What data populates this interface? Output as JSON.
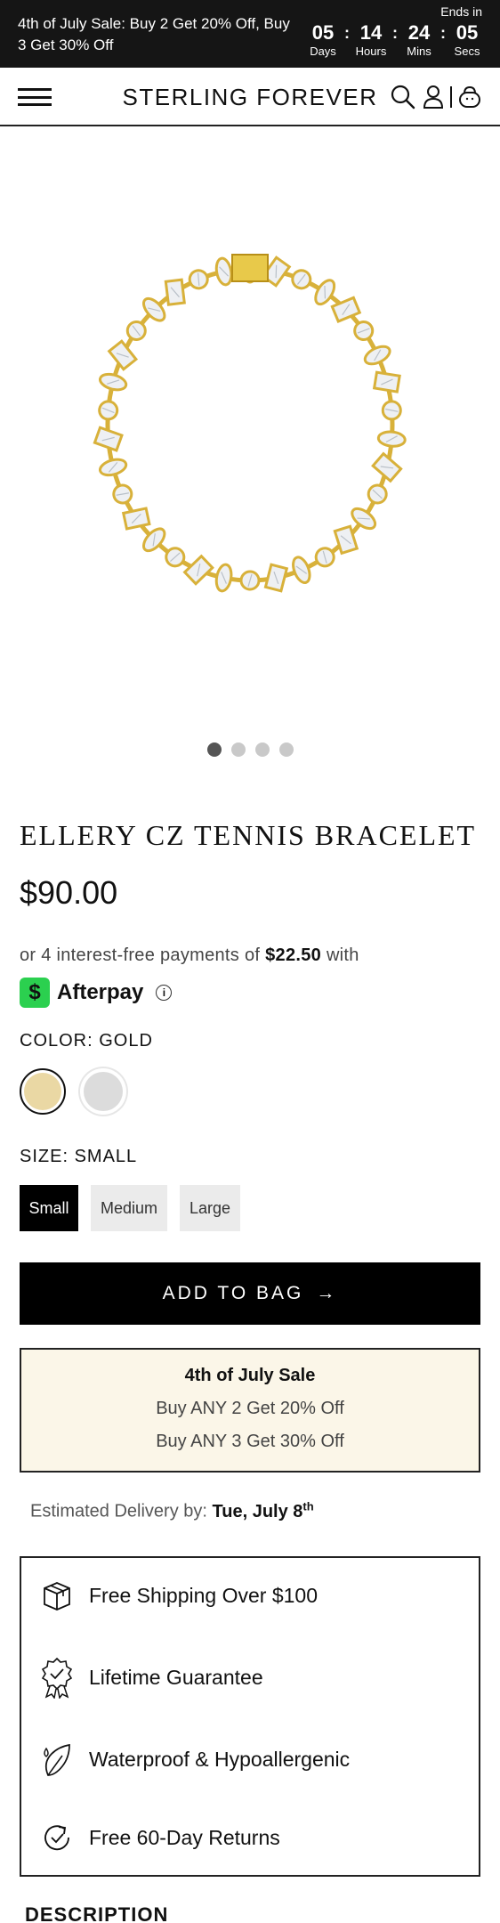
{
  "promo": {
    "text": "4th of July Sale: Buy 2 Get 20% Off, Buy 3 Get 30% Off",
    "ends_in": "Ends in",
    "countdown": [
      {
        "value": "05",
        "label": "Days"
      },
      {
        "value": "14",
        "label": "Hours"
      },
      {
        "value": "24",
        "label": "Mins"
      },
      {
        "value": "05",
        "label": "Secs"
      }
    ],
    "separator": ":"
  },
  "header": {
    "brand": "STERLING FOREVER",
    "icons": [
      "menu-icon",
      "search-icon",
      "account-icon",
      "bag-icon"
    ]
  },
  "gallery": {
    "slide_count": 4,
    "active_slide": 1
  },
  "product": {
    "title": "ELLERY CZ TENNIS BRACELET",
    "price": "$90.00",
    "afterpay": {
      "prefix": "or 4 interest-free payments of",
      "amount": "$22.50",
      "suffix": "with",
      "brand": "Afterpay",
      "logo_glyph": "$",
      "info_glyph": "i"
    },
    "color": {
      "label": "COLOR: GOLD",
      "options": [
        {
          "name": "Gold",
          "hex": "#ead8a4",
          "selected": true
        },
        {
          "name": "Silver",
          "hex": "#dcdcdc",
          "selected": false
        }
      ]
    },
    "size": {
      "label": "SIZE: SMALL",
      "options": [
        {
          "label": "Small",
          "selected": true
        },
        {
          "label": "Medium",
          "selected": false
        },
        {
          "label": "Large",
          "selected": false
        }
      ]
    },
    "add_to_bag": "ADD TO BAG",
    "add_to_bag_arrow": "→"
  },
  "sale_box": {
    "title": "4th of July Sale",
    "line1": "Buy ANY 2 Get 20% Off",
    "line2": "Buy ANY 3 Get 30% Off"
  },
  "delivery": {
    "prefix": "Estimated Delivery by:",
    "date": "Tue, July 8",
    "suffix": "th"
  },
  "benefits": [
    {
      "icon": "shipping-box-icon",
      "label": "Free Shipping Over $100"
    },
    {
      "icon": "guarantee-badge-icon",
      "label": "Lifetime Guarantee"
    },
    {
      "icon": "leaf-water-icon",
      "label": "Waterproof & Hypoallergenic"
    },
    {
      "icon": "return-arrow-icon",
      "label": "Free 60-Day Returns"
    }
  ],
  "description_heading": "DESCRIPTION",
  "colors": {
    "promo_bg": "#151515",
    "sale_box_bg": "#fbf6e8",
    "afterpay_green": "#2bd04f",
    "gold": "#d8b13a"
  }
}
